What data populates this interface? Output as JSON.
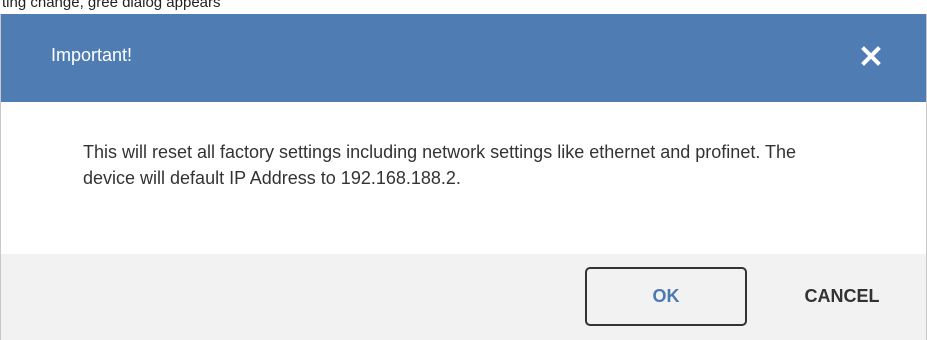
{
  "background_hint": {
    "text": "ting change, gree dialog appears"
  },
  "dialog": {
    "title": "Important!",
    "close_icon": "close-icon",
    "message": "This will reset all factory settings including network settings like ethernet and profinet. The device will default IP Address to 192.168.188.2.",
    "buttons": {
      "ok_label": "OK",
      "cancel_label": "CANCEL"
    }
  },
  "colors": {
    "header": "#4f7db3",
    "header_text": "#ffffff",
    "footer": "#f2f2f2",
    "ok_text": "#4a7ab0",
    "body_text": "#333333"
  }
}
